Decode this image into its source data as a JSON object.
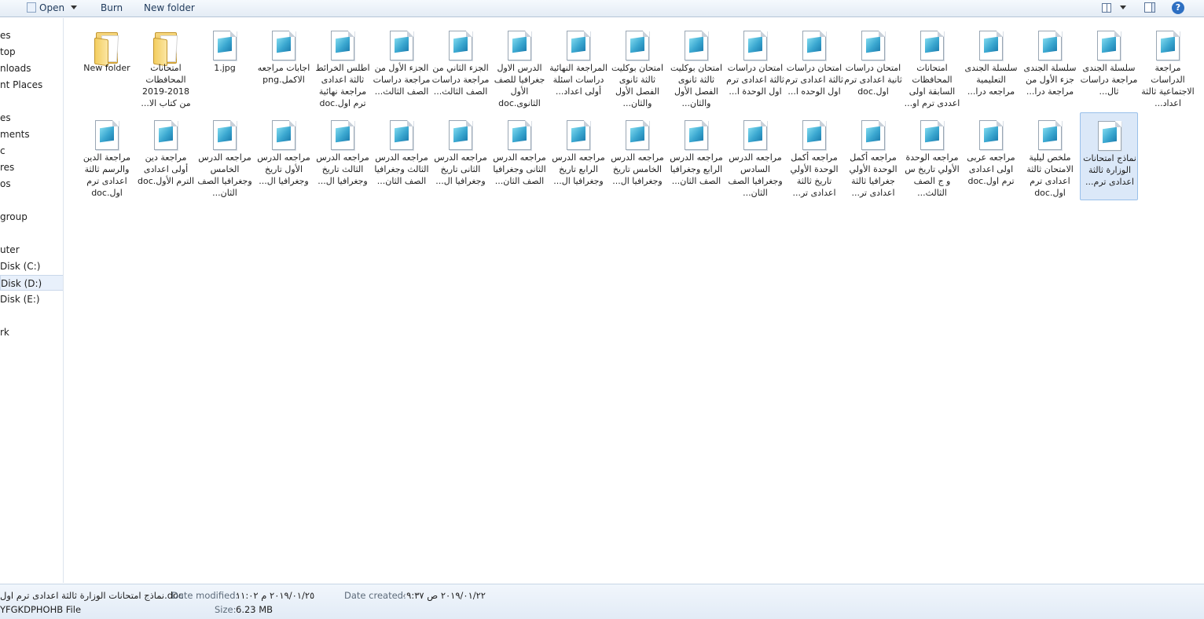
{
  "toolbar": {
    "open_label": "Open",
    "burn_label": "Burn",
    "new_folder_label": "New folder"
  },
  "nav": {
    "items": [
      "es",
      "top",
      "nloads",
      "nt Places",
      "es",
      "ments",
      "c",
      "res",
      "os",
      "group",
      "uter",
      "Disk (C:)",
      "Disk (D:)",
      "Disk (E:)",
      "rk"
    ],
    "selected_index": 12
  },
  "files": [
    {
      "label": "New folder",
      "type": "folder"
    },
    {
      "label": "امتحانات المحافظات 2018-2019 من كتاب الا...",
      "type": "folder"
    },
    {
      "label": "1.jpg",
      "type": "doc"
    },
    {
      "label": "اجابات مراجعه الاكمل.png",
      "type": "doc"
    },
    {
      "label": "اطلس الخرائط ثالثة اعدادى مراجعة نهائية ترم اول.doc",
      "type": "doc"
    },
    {
      "label": "الجزء الأول من مراجعة دراسات الصف الثالث...",
      "type": "doc"
    },
    {
      "label": "الجزء الثاني من مراجعة دراسات الصف الثالث...",
      "type": "doc"
    },
    {
      "label": "الدرس الاول جغرافيا للصف الأول الثانوى.doc",
      "type": "doc"
    },
    {
      "label": "المراجعة النهائية دراسات اسئلة أولى اعداد...",
      "type": "doc"
    },
    {
      "label": "امتحان بوكليت ثالثة ثانوى الفصل الأول والثان...",
      "type": "doc"
    },
    {
      "label": "امتحان بوكليت ثالثة ثانوى الفصل الأول والثان...",
      "type": "doc"
    },
    {
      "label": "امتحان دراسات ثالثة اعدادى ترم اول الوحدة ا...",
      "type": "doc"
    },
    {
      "label": "امتحان دراسات ثالثة اعدادى ترم اول الوحده ا...",
      "type": "doc"
    },
    {
      "label": "امتحان دراسات ثانية اعدادى ترم اول.doc",
      "type": "doc"
    },
    {
      "label": "امتحانات المحافظات السابقة اولى اعددى ترم او...",
      "type": "doc"
    },
    {
      "label": "سلسلة الجندى التعليمية مراجعه درا...",
      "type": "doc"
    },
    {
      "label": "سلسلة الجندى جزء الأول من مراجعة درا...",
      "type": "doc"
    },
    {
      "label": "سلسلة الجندى مراجعة دراسات ثال...",
      "type": "doc"
    },
    {
      "label": "مراجعة الدراسات الاجتماعية ثالثة اعداد...",
      "type": "doc"
    },
    {
      "label": "مراجعة الدين والرسم ثالثة اعدادى ترم اول.doc",
      "type": "doc"
    },
    {
      "label": "مراجعة دين أولى اعدادى الترم الأول.doc",
      "type": "doc"
    },
    {
      "label": "مراجعه الدرس الخامس وجغرافيا الصف الثان...",
      "type": "doc"
    },
    {
      "label": "مراجعه الدرس الأول تاريخ وجغرافيا ال...",
      "type": "doc"
    },
    {
      "label": "مراجعه الدرس الثالث تاريخ وجغرافيا ال...",
      "type": "doc"
    },
    {
      "label": "مراجعه الدرس الثالث وجغرافيا الصف الثان...",
      "type": "doc"
    },
    {
      "label": "مراجعه الدرس الثانى تاريخ وجغرافيا ال...",
      "type": "doc"
    },
    {
      "label": "مراجعه الدرس الثانى وجغرافيا الصف الثان...",
      "type": "doc"
    },
    {
      "label": "مراجعه الدرس الرابع تاريخ وجغرافيا ال...",
      "type": "doc"
    },
    {
      "label": "مراجعه الدرس الخامس تاريخ وجغرافيا ال...",
      "type": "doc"
    },
    {
      "label": "مراجعه الدرس الرابع وجغرافيا الصف الثان...",
      "type": "doc"
    },
    {
      "label": "مراجعه الدرس السادس وجغرافيا الصف الثان...",
      "type": "doc"
    },
    {
      "label": "مراجعه أكمل الوحدة الأولي تاريخ ثالثة اعدادى تر...",
      "type": "doc"
    },
    {
      "label": "مراجعه أكمل الوحدة الأولي جغرافيا ثالثة اعدادى تر...",
      "type": "doc"
    },
    {
      "label": "مراجعه الوحدة الأولي تاريخ س و ج الصف الثالث...",
      "type": "doc"
    },
    {
      "label": "مراجعه عربى اولى اعدادى ترم اول.doc",
      "type": "doc"
    },
    {
      "label": "ملخص ليلية الامتحان ثالثة اعدادى ترم اول.doc",
      "type": "doc"
    },
    {
      "label": "نماذج امتحانات الوزارة ثالثة اعدادى ترم...",
      "type": "doc",
      "selected": true
    }
  ],
  "details": {
    "filename": "نماذج امتحانات الوزارة ثالثة اعدادى ترم اول.doc",
    "type": "YFGKDPHOHB File",
    "date_modified_key": "Date modified:",
    "date_modified_val": "٢٠١٩/٠١/٢٥ م ١١:٠٢",
    "size_key": "Size:",
    "size_val": "6.23 MB",
    "date_created_key": "Date created:",
    "date_created_val": "٢٠١٩/٠١/٢٢ ص ٠٩:٣٧"
  }
}
